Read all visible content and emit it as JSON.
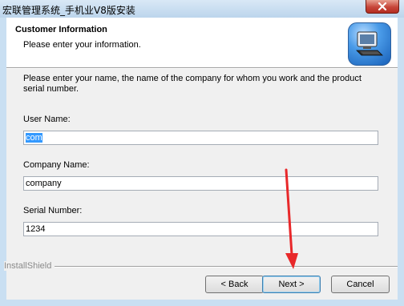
{
  "window": {
    "title": "宏联管理系统_手机业V8版安装"
  },
  "header": {
    "title": "Customer Information",
    "subtitle": "Please enter your information."
  },
  "body": {
    "instructions": "Please enter your name, the name of the company for whom you work and the product serial number."
  },
  "fields": {
    "user_name": {
      "label": "User Name:",
      "value": "com"
    },
    "company_name": {
      "label": "Company Name:",
      "value": "company"
    },
    "serial_number": {
      "label": "Serial Number:",
      "value": "1234"
    }
  },
  "footer": {
    "brand": "InstallShield",
    "back_label": "< Back",
    "next_label": "Next >",
    "cancel_label": "Cancel"
  },
  "annotation": {
    "arrow_color": "#e8282a"
  }
}
